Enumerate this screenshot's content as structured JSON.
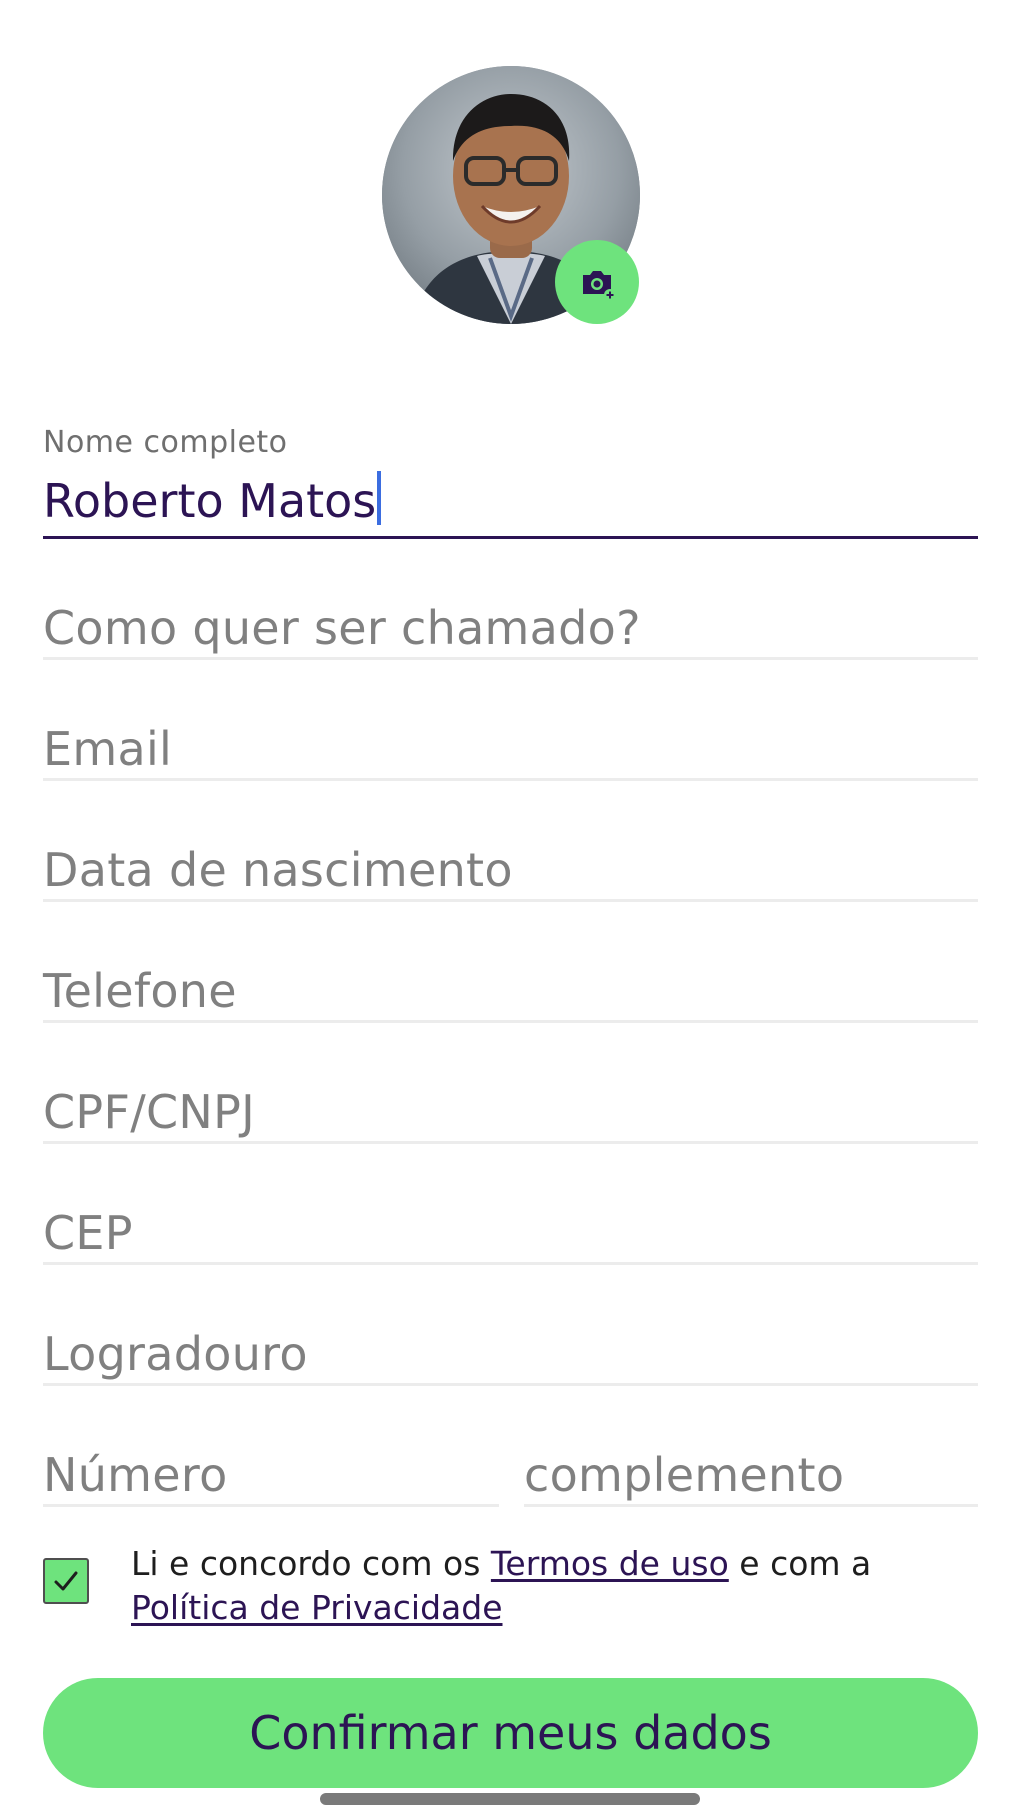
{
  "profile": {
    "avatar_alt": "profile-photo",
    "camera_icon": "camera-add-icon"
  },
  "form": {
    "full_name": {
      "label": "Nome completo",
      "value": "Roberto Matos"
    },
    "nickname": {
      "placeholder": "Como quer ser chamado?"
    },
    "email": {
      "placeholder": "Email"
    },
    "birth_date": {
      "placeholder": "Data de nascimento"
    },
    "phone": {
      "placeholder": "Telefone"
    },
    "document": {
      "placeholder": "CPF/CNPJ"
    },
    "zip": {
      "placeholder": "CEP"
    },
    "street": {
      "placeholder": "Logradouro"
    },
    "number": {
      "placeholder": "Número"
    },
    "complement": {
      "placeholder": "complemento"
    }
  },
  "terms": {
    "checked": true,
    "prefix": "Li e concordo com os ",
    "terms_link": "Termos de uso",
    "middle": " e com a ",
    "privacy_link": "Política de Privacidade"
  },
  "actions": {
    "confirm_label": "Confirmar meus dados"
  },
  "colors": {
    "accent_green": "#6ee37d",
    "brand_purple": "#2c1454",
    "caret_blue": "#3b6de0",
    "placeholder_gray": "#808080"
  }
}
